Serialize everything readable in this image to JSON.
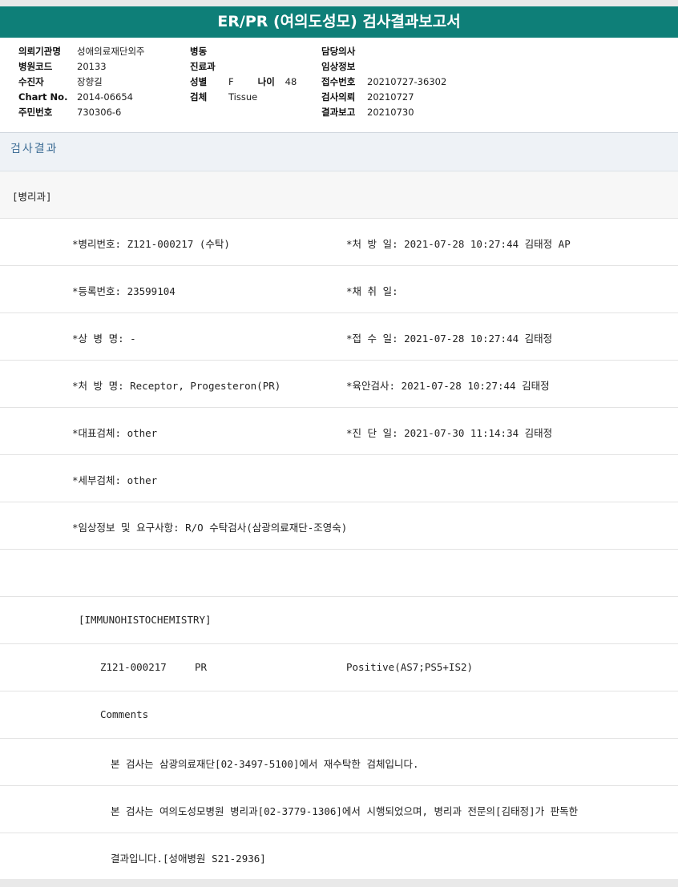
{
  "title": "ER/PR (여의도성모) 검사결과보고서",
  "header_info": {
    "hospital_label": "의뢰기관명",
    "hospital_value": "성애의료재단외주",
    "hospcode_label": "병원코드",
    "hospcode_value": "20133",
    "patient_label": "수진자",
    "patient_value": "장향길",
    "chart_label": "Chart No.",
    "chart_value": "2014-06654",
    "rrn_label": "주민번호",
    "rrn_value": "730306-6",
    "ward_label": "병동",
    "ward_value": "",
    "dept_label": "진료과",
    "dept_value": "",
    "sex_label": "성별",
    "sex_value": "F",
    "age_label": "나이",
    "age_value": "48",
    "specimen_label": "검체",
    "specimen_value": "Tissue",
    "doctor_label": "담당의사",
    "doctor_value": "",
    "clinical_label": "임상정보",
    "clinical_value": "",
    "receipt_label": "접수번호",
    "receipt_value": "20210727-36302",
    "request_label": "검사의뢰",
    "request_value": "20210727",
    "report_label": "결과보고",
    "report_value": "20210730"
  },
  "section_title": "검사결과",
  "result": {
    "dept_tag": "[병리과]",
    "pathology_no": "*병리번호: Z121-000217 (수탁)",
    "prescription_date": "*처 방 일: 2021-07-28 10:27:44  김태정 AP",
    "registration_no": "*등록번호: 23599104",
    "collection_date": "*채 취 일:",
    "diagnosis_name": "*상 병 명: -",
    "receipt_date": "*접 수 일: 2021-07-28 10:27:44  김태정",
    "prescription_name": "*처 방 명: Receptor, Progesteron(PR)",
    "gross_exam": "*육안검사: 2021-07-28 10:27:44  김태정",
    "main_specimen": "*대표검체: other",
    "diagnosis_date": "*진 단 일: 2021-07-30 11:14:34  김태정",
    "sub_specimen": "*세부검체: other",
    "clinical_request": "*임상정보 및 요구사항: R/O 수탁검사(삼광의료재단-조영숙)",
    "ihc_header": "[IMMUNOHISTOCHEMISTRY]",
    "ihc_id": "Z121-000217",
    "ihc_marker": "PR",
    "ihc_result": "Positive(AS7;PS5+IS2)",
    "comments_label": "Comments",
    "comment_1": "본 검사는 삼광의료재단[02-3497-5100]에서 재수탁한 검체입니다.",
    "comment_2": "본 검사는 여의도성모병원 병리과[02-3779-1306]에서 시행되었으며, 병리과 전문의[김태정]가 판독한",
    "comment_3": "결과입니다.[성애병원 S21-2936]"
  }
}
